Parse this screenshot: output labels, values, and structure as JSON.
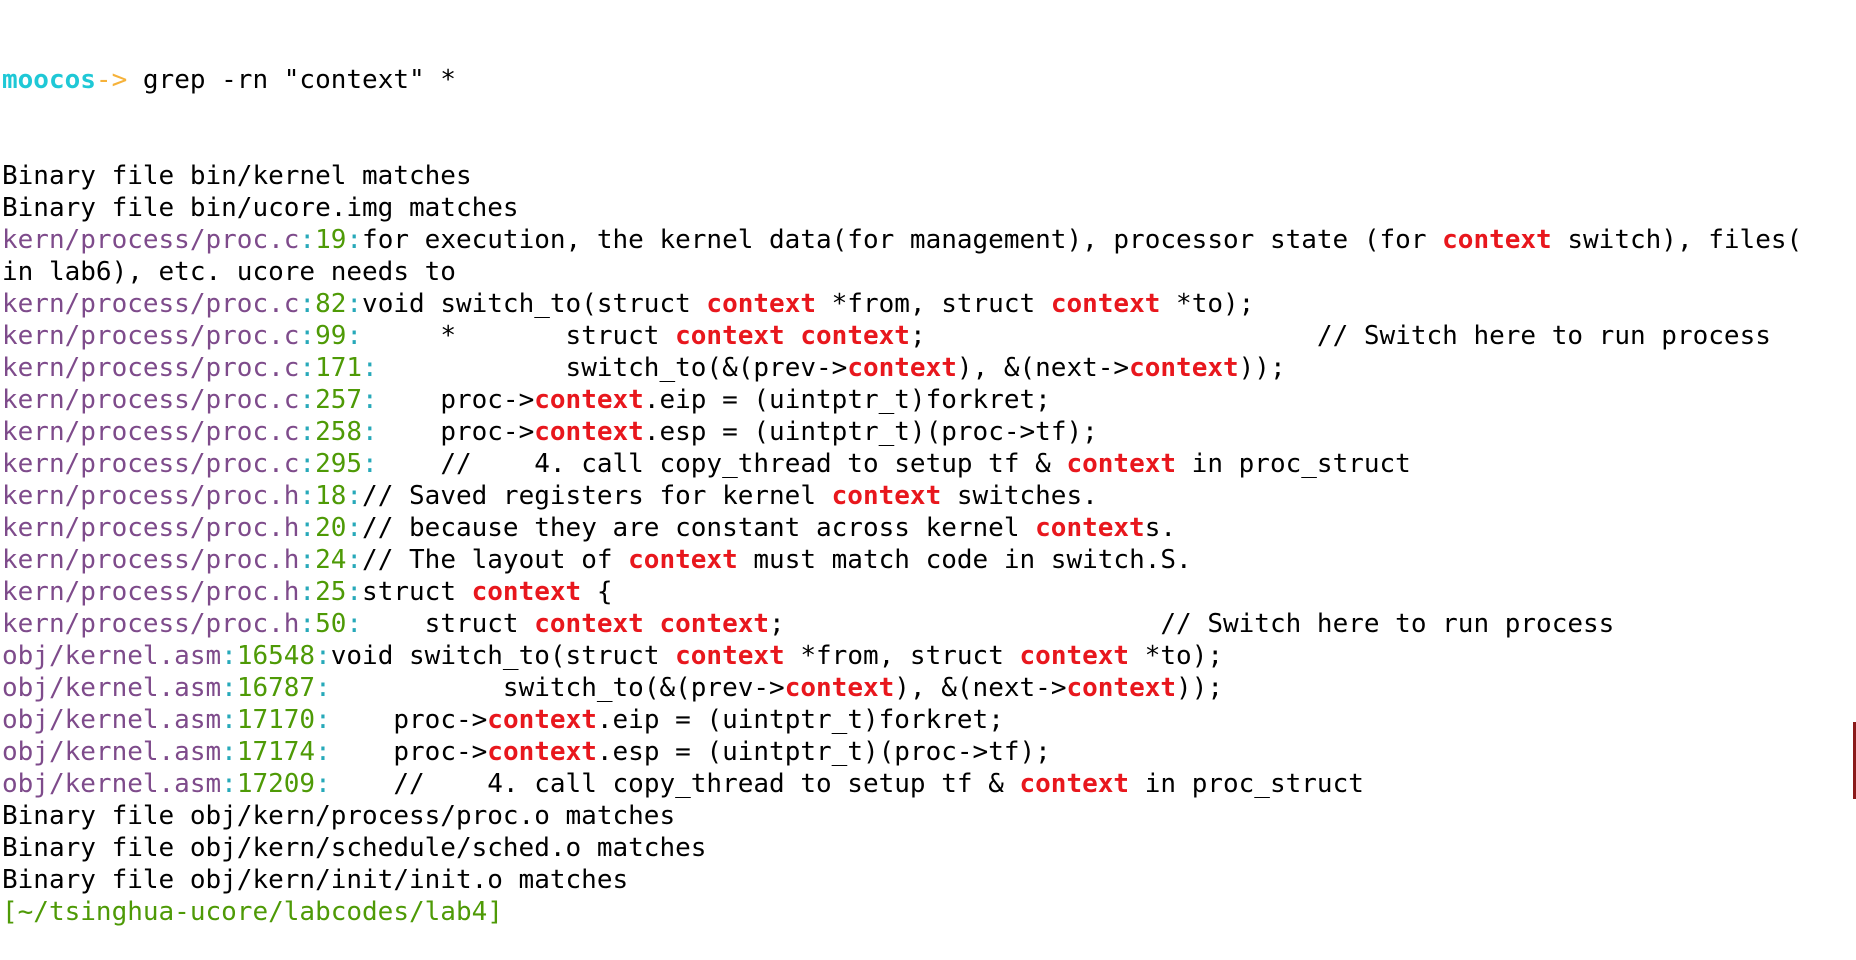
{
  "prompt": {
    "user": "moocos",
    "arrow": "->",
    "command": " grep -rn \"context\" *"
  },
  "lines": [
    {
      "kind": "text",
      "text": "Binary file bin/kernel matches"
    },
    {
      "kind": "text",
      "text": "Binary file bin/ucore.img matches"
    },
    {
      "kind": "match",
      "file": "kern/process/proc.c",
      "line": "19",
      "segments": [
        {
          "t": "for execution, the kernel data(for management), processor state (for "
        },
        {
          "t": "context",
          "hit": true
        },
        {
          "t": " switch), files("
        }
      ]
    },
    {
      "kind": "text",
      "text": "in lab6), etc. ucore needs to"
    },
    {
      "kind": "match",
      "file": "kern/process/proc.c",
      "line": "82",
      "segments": [
        {
          "t": "void switch_to(struct "
        },
        {
          "t": "context",
          "hit": true
        },
        {
          "t": " *from, struct "
        },
        {
          "t": "context",
          "hit": true
        },
        {
          "t": " *to);"
        }
      ]
    },
    {
      "kind": "match",
      "file": "kern/process/proc.c",
      "line": "99",
      "segments": [
        {
          "t": "     *       struct "
        },
        {
          "t": "context",
          "hit": true
        },
        {
          "t": " "
        },
        {
          "t": "context",
          "hit": true
        },
        {
          "t": ";                         // Switch here to run process"
        }
      ]
    },
    {
      "kind": "match",
      "file": "kern/process/proc.c",
      "line": "171",
      "segments": [
        {
          "t": "            switch_to(&(prev->"
        },
        {
          "t": "context",
          "hit": true
        },
        {
          "t": "), &(next->"
        },
        {
          "t": "context",
          "hit": true
        },
        {
          "t": "));"
        }
      ]
    },
    {
      "kind": "match",
      "file": "kern/process/proc.c",
      "line": "257",
      "segments": [
        {
          "t": "    proc->"
        },
        {
          "t": "context",
          "hit": true
        },
        {
          "t": ".eip = (uintptr_t)forkret;"
        }
      ]
    },
    {
      "kind": "match",
      "file": "kern/process/proc.c",
      "line": "258",
      "segments": [
        {
          "t": "    proc->"
        },
        {
          "t": "context",
          "hit": true
        },
        {
          "t": ".esp = (uintptr_t)(proc->tf);"
        }
      ]
    },
    {
      "kind": "match",
      "file": "kern/process/proc.c",
      "line": "295",
      "segments": [
        {
          "t": "    //    4. call copy_thread to setup tf & "
        },
        {
          "t": "context",
          "hit": true
        },
        {
          "t": " in proc_struct"
        }
      ]
    },
    {
      "kind": "match",
      "file": "kern/process/proc.h",
      "line": "18",
      "segments": [
        {
          "t": "// Saved registers for kernel "
        },
        {
          "t": "context",
          "hit": true
        },
        {
          "t": " switches."
        }
      ]
    },
    {
      "kind": "match",
      "file": "kern/process/proc.h",
      "line": "20",
      "segments": [
        {
          "t": "// because they are constant across kernel "
        },
        {
          "t": "context",
          "hit": true
        },
        {
          "t": "s."
        }
      ]
    },
    {
      "kind": "match",
      "file": "kern/process/proc.h",
      "line": "24",
      "segments": [
        {
          "t": "// The layout of "
        },
        {
          "t": "context",
          "hit": true
        },
        {
          "t": " must match code in switch.S."
        }
      ]
    },
    {
      "kind": "match",
      "file": "kern/process/proc.h",
      "line": "25",
      "segments": [
        {
          "t": "struct "
        },
        {
          "t": "context",
          "hit": true
        },
        {
          "t": " {"
        }
      ]
    },
    {
      "kind": "match",
      "file": "kern/process/proc.h",
      "line": "50",
      "segments": [
        {
          "t": "    struct "
        },
        {
          "t": "context",
          "hit": true
        },
        {
          "t": " "
        },
        {
          "t": "context",
          "hit": true
        },
        {
          "t": ";                        // Switch here to run process"
        }
      ]
    },
    {
      "kind": "match",
      "file": "obj/kernel.asm",
      "line": "16548",
      "segments": [
        {
          "t": "void switch_to(struct "
        },
        {
          "t": "context",
          "hit": true
        },
        {
          "t": " *from, struct "
        },
        {
          "t": "context",
          "hit": true
        },
        {
          "t": " *to);"
        }
      ]
    },
    {
      "kind": "match",
      "file": "obj/kernel.asm",
      "line": "16787",
      "segments": [
        {
          "t": "           switch_to(&(prev->"
        },
        {
          "t": "context",
          "hit": true
        },
        {
          "t": "), &(next->"
        },
        {
          "t": "context",
          "hit": true
        },
        {
          "t": "));"
        }
      ]
    },
    {
      "kind": "match",
      "file": "obj/kernel.asm",
      "line": "17170",
      "segments": [
        {
          "t": "    proc->"
        },
        {
          "t": "context",
          "hit": true
        },
        {
          "t": ".eip = (uintptr_t)forkret;"
        }
      ]
    },
    {
      "kind": "match",
      "file": "obj/kernel.asm",
      "line": "17174",
      "segments": [
        {
          "t": "    proc->"
        },
        {
          "t": "context",
          "hit": true
        },
        {
          "t": ".esp = (uintptr_t)(proc->tf);"
        }
      ]
    },
    {
      "kind": "match",
      "file": "obj/kernel.asm",
      "line": "17209",
      "segments": [
        {
          "t": "    //    4. call copy_thread to setup tf & "
        },
        {
          "t": "context",
          "hit": true
        },
        {
          "t": " in proc_struct"
        }
      ]
    },
    {
      "kind": "text",
      "text": "Binary file obj/kern/process/proc.o matches"
    },
    {
      "kind": "text",
      "text": "Binary file obj/kern/schedule/sched.o matches"
    },
    {
      "kind": "text",
      "text": "Binary file obj/kern/init/init.o matches"
    },
    {
      "kind": "cwd",
      "text": "[~/tsinghua-ucore/labcodes/lab4]"
    }
  ],
  "colors": {
    "filename": "#7e4b8b",
    "separator": "#27a9b9",
    "line_number": "#4e9a06",
    "match": "#e8171d",
    "prompt_user": "#1fc8d6",
    "prompt_arrow": "#f6b23a"
  }
}
